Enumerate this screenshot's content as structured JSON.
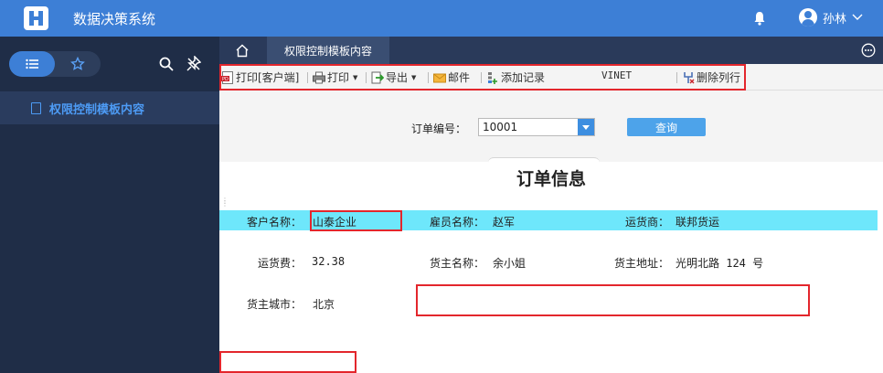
{
  "app": {
    "title": "数据决策系统",
    "user": "孙林"
  },
  "sidebar": {
    "items": [
      {
        "label": "权限控制模板内容"
      }
    ]
  },
  "tabs": {
    "active": "权限控制模板内容"
  },
  "toolbar": {
    "print_client": "打印[客户端]",
    "print": "打印",
    "export": "导出",
    "email": "邮件",
    "add_record": "添加记录",
    "vinet": "VINET",
    "delete_row": "删除列行"
  },
  "query": {
    "order_label": "订单编号：",
    "order_value": "10001",
    "search_button": "查询"
  },
  "report": {
    "title": "订单信息",
    "customer_label": "客户名称：",
    "customer_value": "山泰企业",
    "employee_label": "雇员名称：",
    "employee_value": "赵军",
    "shipper_label": "运货商：",
    "shipper_value": "联邦货运",
    "freight_label": "运货费：",
    "freight_value": "32.38",
    "owner_label": "货主名称：",
    "owner_value": "余小姐",
    "address_label": "货主地址：",
    "address_value": "光明北路 124 号",
    "city_label": "货主城市：",
    "city_value": "北京"
  },
  "colors": {
    "brand": "#3d7fd6",
    "sidebar": "#1f2d47",
    "highlight_row": "#6ee7fb",
    "annotation": "#e3262c"
  }
}
